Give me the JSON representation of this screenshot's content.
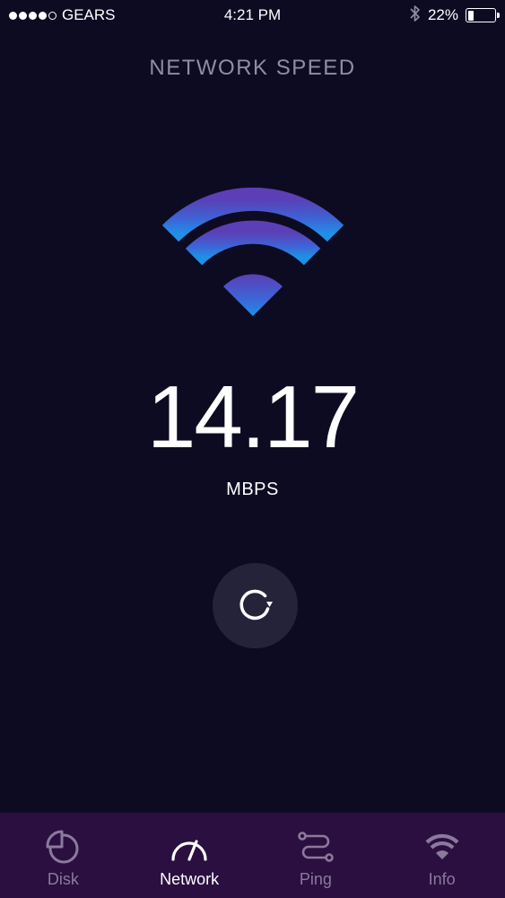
{
  "status_bar": {
    "carrier": "GEARS",
    "signal_strength": 4,
    "signal_max": 5,
    "time": "4:21 PM",
    "bluetooth_icon": "bluetooth-icon",
    "battery_percent": "22%",
    "battery_level": 0.22
  },
  "header": {
    "title": "NETWORK SPEED"
  },
  "main": {
    "wifi_icon": "wifi-icon",
    "speed_value": "14.17",
    "speed_unit": "MBPS",
    "refresh_icon": "refresh-icon"
  },
  "tab_bar": {
    "active": "Network",
    "tabs": [
      {
        "label": "Disk",
        "icon": "pie-chart-icon"
      },
      {
        "label": "Network",
        "icon": "speedometer-icon"
      },
      {
        "label": "Ping",
        "icon": "ping-route-icon"
      },
      {
        "label": "Info",
        "icon": "wifi-icon"
      }
    ]
  },
  "colors": {
    "background": "#0d0b22",
    "wifi_gradient_top": "#5b3fb6",
    "wifi_gradient_bottom": "#1f8fe8",
    "tab_bar": "#2a0f40",
    "tab_inactive": "#8b7a9c",
    "title_gray": "#8e8ea6"
  }
}
